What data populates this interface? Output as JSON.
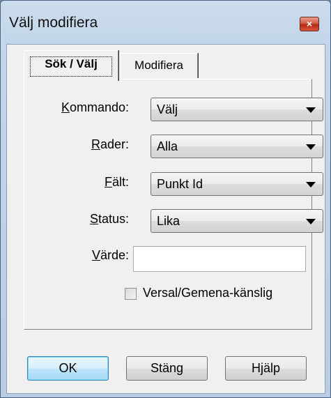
{
  "window": {
    "title": "Välj modifiera",
    "close_glyph": "×"
  },
  "tabs": [
    {
      "label": "Sök / Välj",
      "active": true
    },
    {
      "label": "Modifiera",
      "active": false
    }
  ],
  "form": {
    "kommando": {
      "label_mnemonic": "K",
      "label_rest": "ommando:",
      "value": "Välj"
    },
    "rader": {
      "label_mnemonic": "R",
      "label_rest": "ader:",
      "value": "Alla"
    },
    "falt": {
      "label_mnemonic": "F",
      "label_rest": "ält:",
      "value": "Punkt Id"
    },
    "status": {
      "label_mnemonic": "S",
      "label_rest": "tatus:",
      "value": "Lika"
    },
    "varde": {
      "label_mnemonic": "V",
      "label_rest": "ärde:",
      "value": ""
    },
    "case_sensitive": {
      "label": "Versal/Gemena-känslig",
      "checked": false
    }
  },
  "buttons": {
    "ok": "OK",
    "close": "Stäng",
    "help": "Hjälp"
  },
  "icons": {
    "close": "close-icon",
    "dropdown": "chevron-down-icon"
  }
}
